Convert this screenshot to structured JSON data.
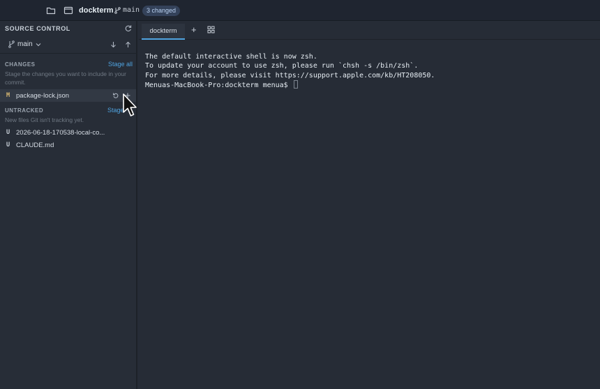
{
  "titlebar": {
    "folder_icon": "folder-icon",
    "window_icon": "window-icon",
    "project": "dockterm",
    "branch": "main",
    "badge": "3 changed"
  },
  "sidebar": {
    "header": "SOURCE CONTROL",
    "branch": "main",
    "changes": {
      "title": "CHANGES",
      "action": "Stage all",
      "description": "Stage the changes you want to include in your commit.",
      "files": [
        {
          "status": "M",
          "name": "package-lock.json"
        }
      ]
    },
    "untracked": {
      "title": "UNTRACKED",
      "action": "Stage",
      "description": "New files Git isn't tracking yet.",
      "files": [
        {
          "status": "U",
          "name": "2026-06-18-170538-local-co..."
        },
        {
          "status": "U",
          "name": "CLAUDE.md"
        }
      ]
    }
  },
  "tabs": {
    "active": "dockterm",
    "add_label": "+"
  },
  "terminal": {
    "lines": [
      "The default interactive shell is now zsh.",
      "To update your account to use zsh, please run `chsh -s /bin/zsh`.",
      "For more details, please visit https://support.apple.com/kb/HT208050.",
      "Menuas-MacBook-Pro:dockterm menua$ "
    ]
  },
  "colors": {
    "accent": "#4fa3e0",
    "modified": "#d8b873",
    "background": "#262c36"
  }
}
